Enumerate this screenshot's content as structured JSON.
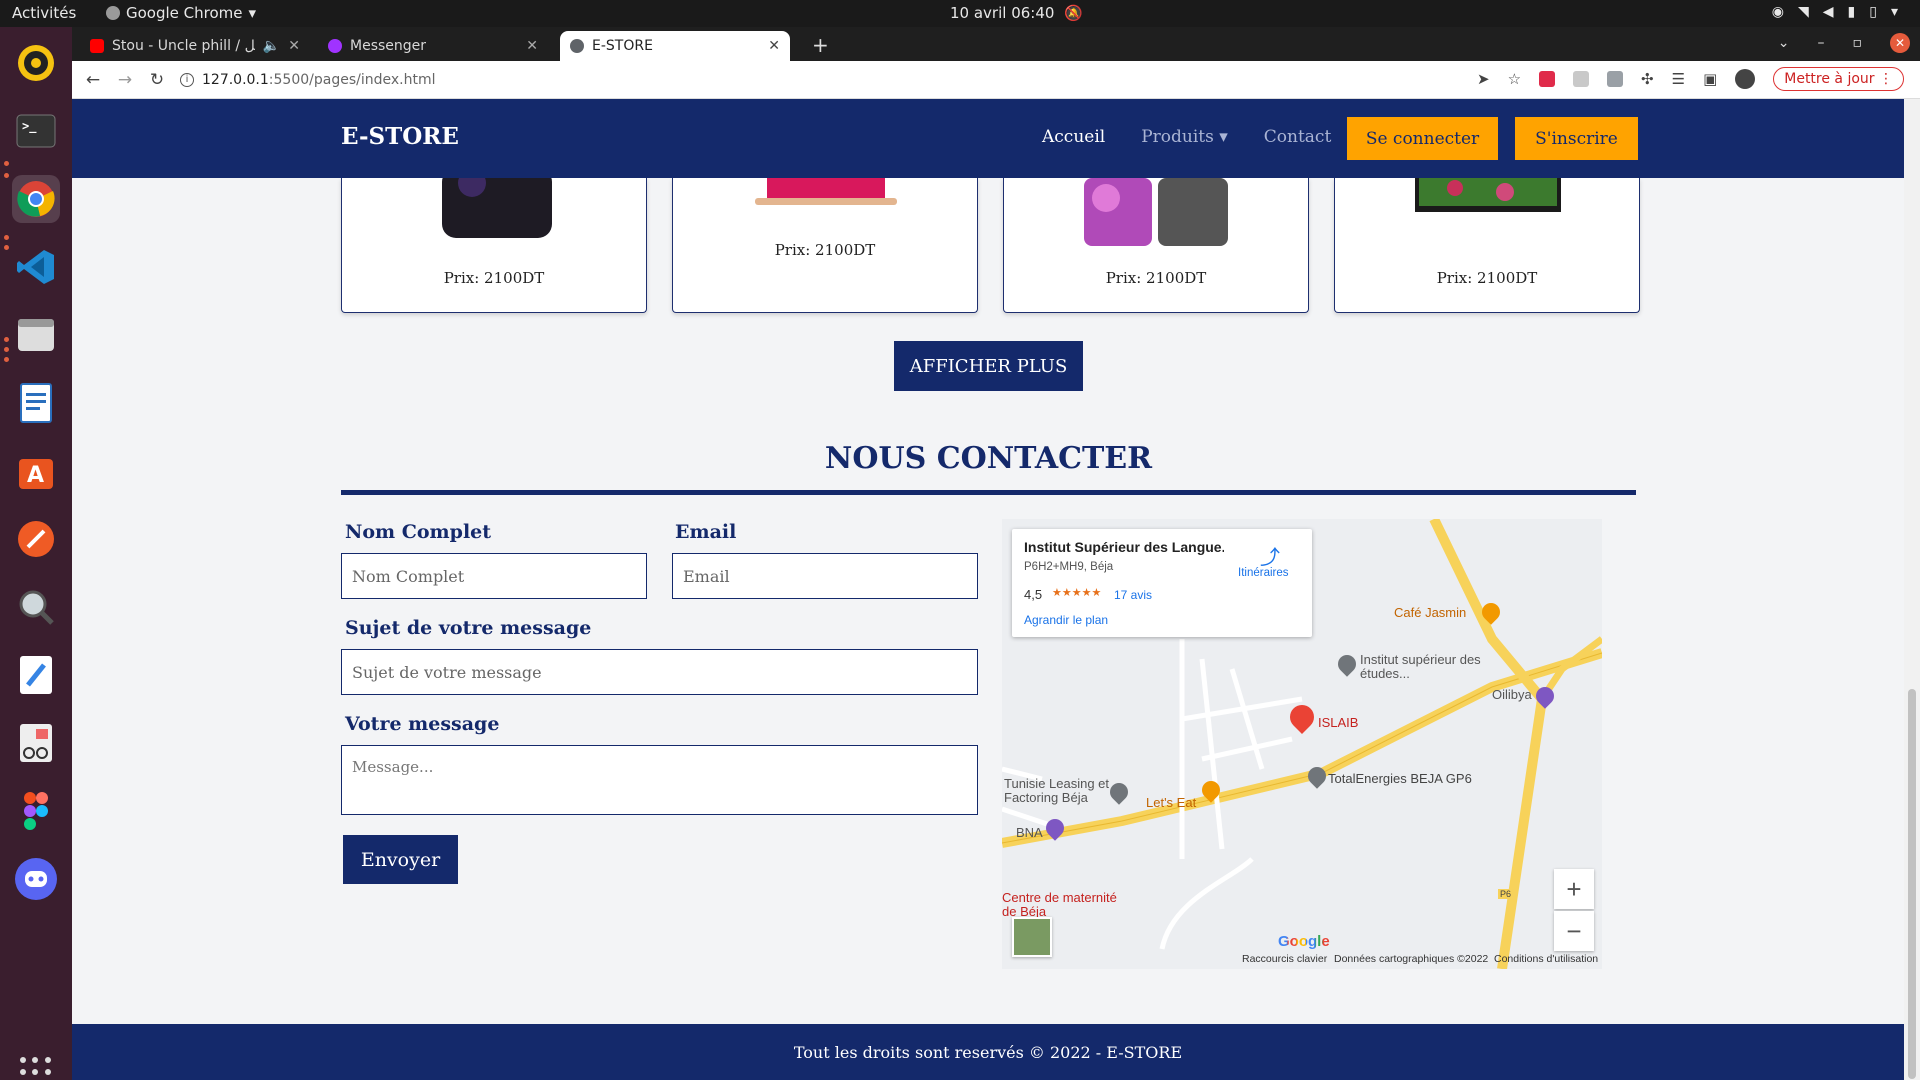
{
  "system": {
    "activities": "Activités",
    "app_name": "Google Chrome",
    "clock": "10 avril  06:40"
  },
  "browser": {
    "tabs": [
      {
        "title": "Stou - Uncle phill / قيل",
        "favicon_color": "#ff0000"
      },
      {
        "title": "Messenger",
        "favicon_color": "#a033ff"
      },
      {
        "title": "E-STORE",
        "favicon_color": "#5f6368"
      }
    ],
    "url_host": "127.0.0.1",
    "url_path": ":5500/pages/index.html",
    "update_label": "Mettre à jour"
  },
  "site": {
    "brand": "E-STORE",
    "nav": {
      "home": "Accueil",
      "products": "Produits ▾",
      "contact": "Contact",
      "login": "Se connecter",
      "signup": "S'inscrire"
    },
    "products": [
      {
        "price": "Prix: 2100DT"
      },
      {
        "price": "Prix: 2100DT"
      },
      {
        "price": "Prix: 2100DT"
      },
      {
        "price": "Prix: 2100DT"
      }
    ],
    "show_more": "AFFICHER PLUS",
    "contact": {
      "title": "NOUS CONTACTER",
      "name_label": "Nom Complet",
      "name_placeholder": "Nom Complet",
      "email_label": "Email",
      "email_placeholder": "Email",
      "subject_label": "Sujet de votre message",
      "subject_placeholder": "Sujet de votre message",
      "message_label": "Votre message",
      "message_placeholder": "Message...",
      "send": "Envoyer"
    },
    "map": {
      "place_name": "Institut Supérieur des Langue...",
      "address": "P6H2+MH9, Béja",
      "rating": "4,5",
      "stars": "★★★★★",
      "reviews": "17 avis",
      "enlarge": "Agrandir le plan",
      "directions": "Itinéraires",
      "labels": {
        "cafe": "Café Jasmin",
        "institut": "Institut supérieur des études...",
        "oilibya": "Oilibya",
        "islaib": "ISLAIB",
        "total": "TotalEnergies BEJA GP6",
        "leasing": "Tunisie Leasing et Factoring Béja",
        "letseat": "Let's Eat",
        "bna": "BNA",
        "maternite": "Centre de maternité de Béja",
        "p6": "P6"
      },
      "google": "Google",
      "shortcuts": "Raccourcis clavier",
      "map_data": "Données cartographiques ©2022",
      "terms": "Conditions d'utilisation"
    },
    "footer": "Tout les droits sont reservés © 2022 - E-STORE"
  },
  "colors": {
    "primary": "#14296b",
    "accent": "#ffa300"
  }
}
